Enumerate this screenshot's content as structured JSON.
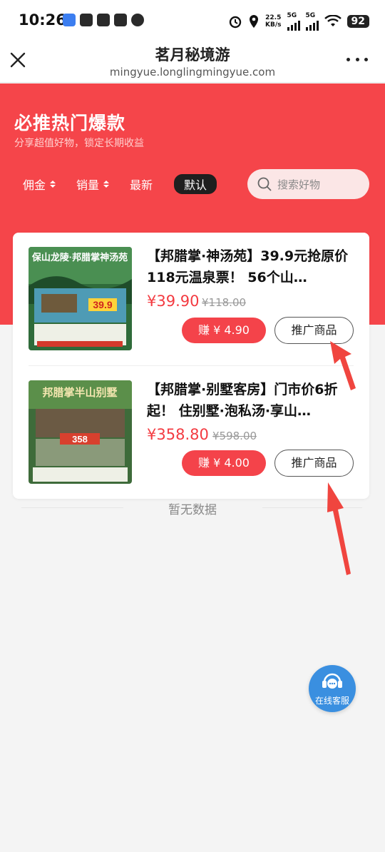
{
  "status_bar": {
    "time": "10:26",
    "speed_value": "22.5",
    "speed_unit": "KB/s",
    "net1": "5G",
    "net2": "5G",
    "battery": "92"
  },
  "nav": {
    "title": "茗月秘境游",
    "url": "mingyue.longlingmingyue.com"
  },
  "banner": {
    "title": "必推热门爆款",
    "subtitle": "分享超值好物，锁定长期收益"
  },
  "filters": [
    {
      "label": "佣金",
      "sortable": true
    },
    {
      "label": "销量",
      "sortable": true
    },
    {
      "label": "最新",
      "sortable": false
    },
    {
      "label": "默认",
      "active": true
    }
  ],
  "search": {
    "placeholder": "搜索好物"
  },
  "products": [
    {
      "title": "【邦腊掌·神汤苑】39.9元抢原价118元温泉票！ 56个山…",
      "price": "¥39.90",
      "original_price": "¥118.00",
      "earn_label": "赚 ¥ 4.90",
      "promote_label": "推广商品",
      "thumb_heading": "保山龙陵·邦腊掌神汤苑",
      "thumb_price": "39.9"
    },
    {
      "title": "【邦腊掌·别墅客房】门市价6折起！ 住别墅·泡私汤·享山…",
      "price": "¥358.80",
      "original_price": "¥598.00",
      "earn_label": "赚 ¥ 4.00",
      "promote_label": "推广商品",
      "thumb_heading": "邦腊掌半山别墅",
      "thumb_price": "358"
    }
  ],
  "empty_text": "暂无数据",
  "customer_service": {
    "label": "在线客服"
  },
  "colors": {
    "brand_red": "#f5454a",
    "price_red": "#f33b41",
    "service_blue": "#3a8fe0"
  }
}
